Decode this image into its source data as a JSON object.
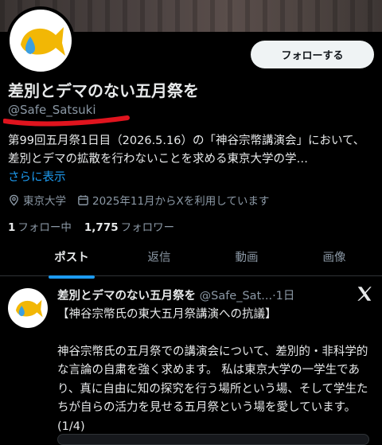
{
  "profile": {
    "display_name": "差別とデマのない五月祭を",
    "handle": "@Safe_Satsuki",
    "follow_button": "フォローする",
    "bio_text": "第99回五月祭1日目（2026.5.16）の「神谷宗幣講演会」において、差別とデマの拡散を行わないことを求める東京大学の学…",
    "bio_more": "さらに表示",
    "location": "東京大学",
    "joined": "2025年11月からXを利用しています",
    "following_count": "1",
    "following_label": "フォロー中",
    "followers_count": "1,775",
    "followers_label": "フォロワー",
    "colors": {
      "accent": "#1d9bf0",
      "fish_yellow": "#f2b705",
      "drop_blue": "#3b9fe0",
      "annotation_red": "#e0141e"
    }
  },
  "tabs": [
    {
      "label": "ポスト",
      "active": true
    },
    {
      "label": "返信",
      "active": false
    },
    {
      "label": "動画",
      "active": false
    },
    {
      "label": "画像",
      "active": false
    }
  ],
  "tweet": {
    "name": "差別とデマのない五月祭を",
    "handle": "@Safe_Sat...",
    "time": "·1日",
    "lines": [
      "【神谷宗幣氏の東大五月祭講演への抗議】",
      "",
      "神谷宗幣氏の五月祭での講演会について、差別的・非科学的な言論の自粛を強く求めます。 私は東京大学の一学生であり、真に自由に知の探究を行う場所という場、そして学生たちが自らの活力を見せる五月祭という場を愛しています。　(1/4)"
    ]
  },
  "icons": [
    "fish-logo-icon",
    "location-pin-icon",
    "calendar-icon",
    "x-logo-icon"
  ]
}
